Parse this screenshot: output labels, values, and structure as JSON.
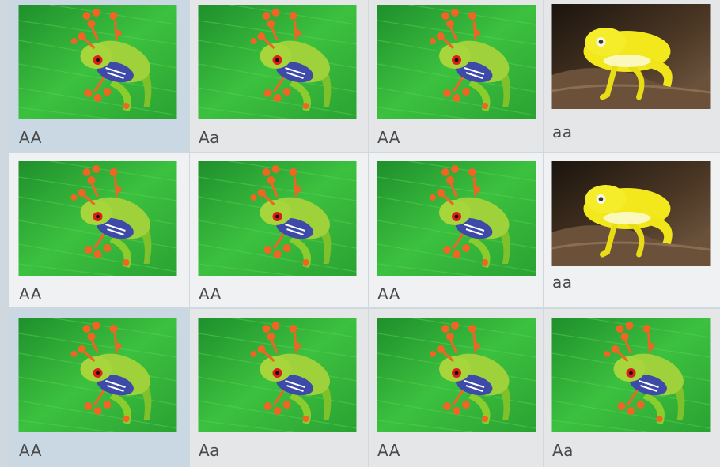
{
  "tiles": [
    {
      "caption": "AA",
      "image": "red-eyed-tree-frog"
    },
    {
      "caption": "Aa",
      "image": "red-eyed-tree-frog"
    },
    {
      "caption": "AA",
      "image": "red-eyed-tree-frog"
    },
    {
      "caption": "aa",
      "image": "yellow-frog"
    },
    {
      "caption": "AA",
      "image": "red-eyed-tree-frog"
    },
    {
      "caption": "AA",
      "image": "red-eyed-tree-frog"
    },
    {
      "caption": "AA",
      "image": "red-eyed-tree-frog"
    },
    {
      "caption": "aa",
      "image": "yellow-frog"
    },
    {
      "caption": "AA",
      "image": "red-eyed-tree-frog"
    },
    {
      "caption": "Aa",
      "image": "red-eyed-tree-frog"
    },
    {
      "caption": "AA",
      "image": "red-eyed-tree-frog"
    },
    {
      "caption": "Aa",
      "image": "red-eyed-tree-frog"
    }
  ],
  "colors": {
    "selected_background": "#c9d8e2",
    "tile_background": "#e4e6e8",
    "caption_text": "#4a4a4a"
  }
}
